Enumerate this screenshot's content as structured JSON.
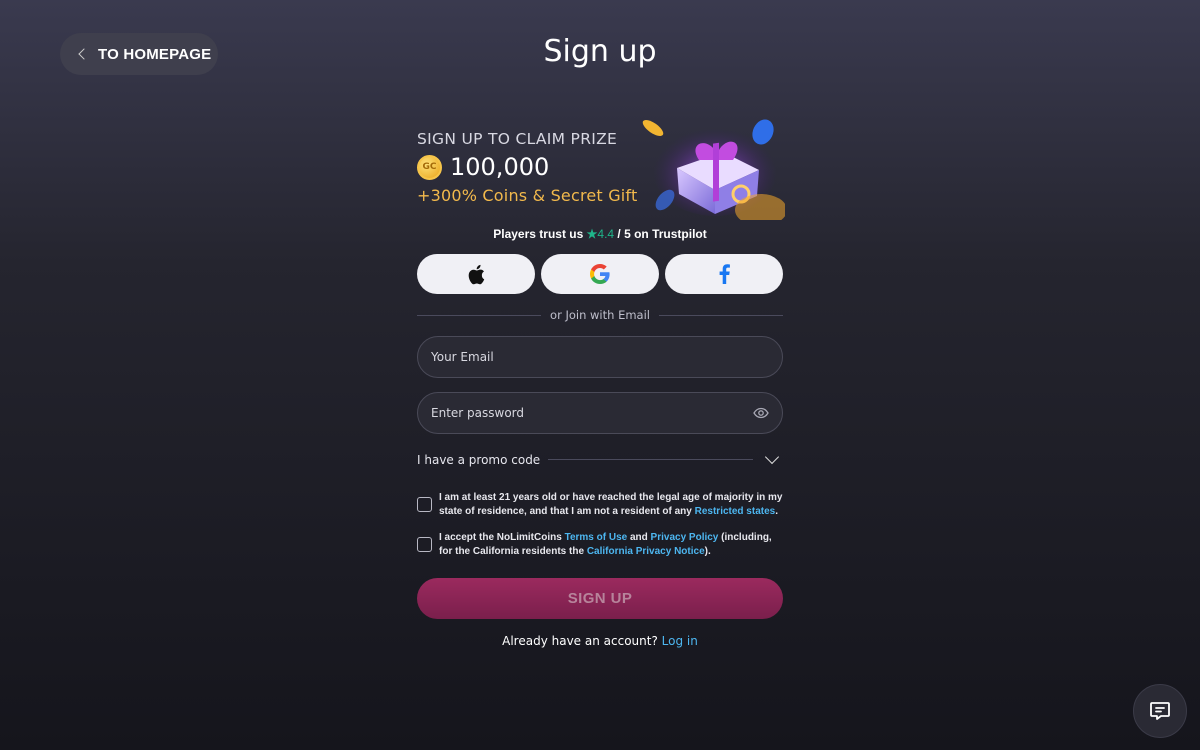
{
  "nav": {
    "back_label": "TO HOMEPAGE"
  },
  "page": {
    "title": "Sign up"
  },
  "promo": {
    "claim_text": "SIGN UP TO CLAIM PRIZE",
    "coin_label": "GC",
    "amount": "100,000",
    "bonus_text": "+300% Coins & Secret Gift",
    "image_icon": "gift-box-icon"
  },
  "trust": {
    "prefix": "Players trust us",
    "star": "★",
    "rating": "4.4",
    "suffix": "/ 5 on Trustpilot"
  },
  "social": [
    {
      "name": "apple",
      "icon": "apple-icon"
    },
    {
      "name": "google",
      "icon": "google-icon"
    },
    {
      "name": "facebook",
      "icon": "facebook-icon"
    }
  ],
  "divider_text": "or Join with Email",
  "form": {
    "email_placeholder": "Your Email",
    "password_placeholder": "Enter password",
    "promo_code_label": "I have a promo code"
  },
  "consent": {
    "age_text": "I am at least 21 years old or have reached the legal age of majority in my state of residence, and that I am not a resident of any",
    "age_link": "Restricted states",
    "age_end": ".",
    "terms_prefix": "I accept the NoLimitCoins",
    "terms_link": "Terms of Use",
    "terms_and": "and",
    "privacy_link": "Privacy Policy",
    "terms_middle": "(including, for the California residents the",
    "california_link": "California Privacy Notice",
    "terms_end": ")."
  },
  "signup_label": "SIGN UP",
  "login": {
    "prompt": "Already have an account?",
    "link": "Log in"
  },
  "colors": {
    "accent_link": "#4db6f0",
    "trust_green": "#1fb58a",
    "bonus_gold": "#f2b94c",
    "signup_button": "#8a2456"
  }
}
